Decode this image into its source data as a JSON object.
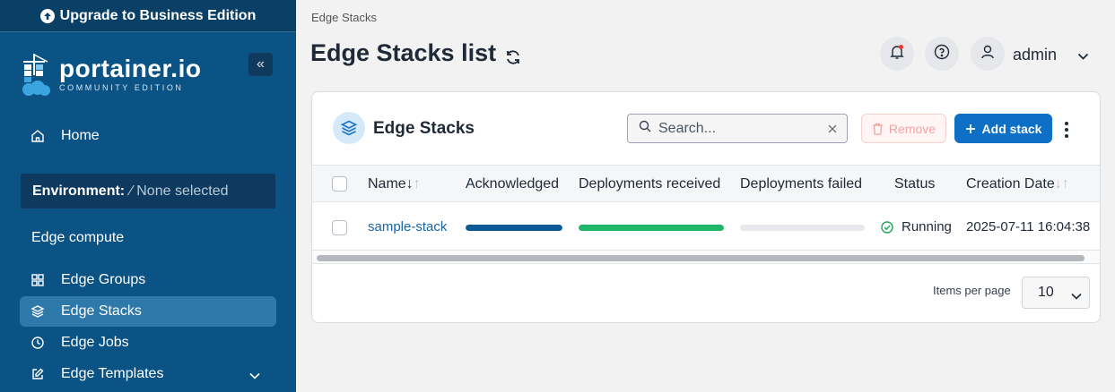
{
  "sidebar": {
    "upgrade_label": "Upgrade to Business Edition",
    "logo_name": "portainer.io",
    "logo_sub": "COMMUNITY EDITION",
    "collapse_label": "«",
    "home_label": "Home",
    "environment": {
      "label": "Environment:",
      "value": "⁄ None selected"
    },
    "section_title": "Edge compute",
    "items": [
      {
        "label": "Edge Groups",
        "icon": "grid-icon"
      },
      {
        "label": "Edge Stacks",
        "icon": "layers-icon"
      },
      {
        "label": "Edge Jobs",
        "icon": "clock-icon"
      },
      {
        "label": "Edge Templates",
        "icon": "edit-icon"
      }
    ]
  },
  "header": {
    "breadcrumb": "Edge Stacks",
    "title": "Edge Stacks list",
    "user_name": "admin"
  },
  "card": {
    "title": "Edge Stacks",
    "search_placeholder": "Search...",
    "remove_label": "Remove",
    "add_label": "Add stack",
    "columns": {
      "name": "Name",
      "acknowledged": "Acknowledged",
      "deployments_received": "Deployments received",
      "deployments_failed": "Deployments failed",
      "status": "Status",
      "creation_date": "Creation Date"
    },
    "rows": [
      {
        "name": "sample-stack",
        "acknowledged_fraction": 1.0,
        "deployments_received_fraction": 1.0,
        "deployments_failed_fraction": 0.0,
        "status": "Running",
        "creation_date": "2025-07-11 16:04:38"
      }
    ],
    "items_per_page_label": "Items per page",
    "items_per_page_value": "10"
  },
  "colors": {
    "sidebar_bg": "#0b5384",
    "accent": "#0d6fc5",
    "acknowledged_bar": "#0b5a96",
    "received_bar": "#1fb767",
    "status_ok": "#22a55b"
  }
}
